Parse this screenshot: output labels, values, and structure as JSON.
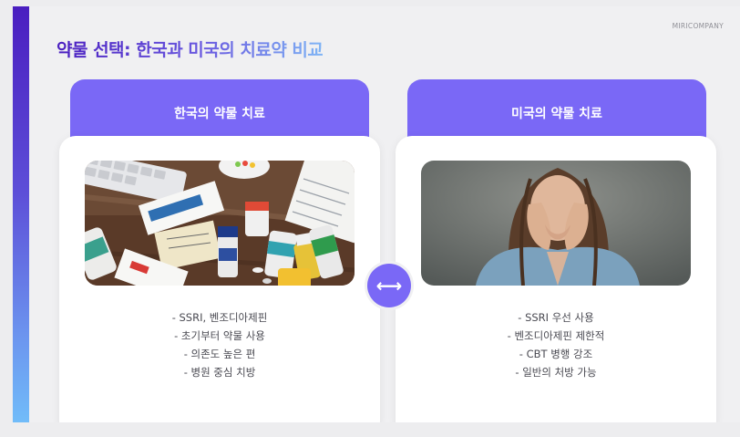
{
  "brand": "MIRICOMPANY",
  "title": "약물 선택: 한국과 미국의 치료약 비교",
  "korea": {
    "header": "한국의 약물 치료",
    "bullets": [
      "- SSRI, 벤조디아제핀",
      "- 초기부터 약물 사용",
      "- 의존도 높은 편",
      "- 병원 중심 치방"
    ]
  },
  "usa": {
    "header": "미국의 약물 치료",
    "bullets": [
      "- SSRI 우선 사용",
      "- 벤조디아제핀 제한적",
      "- CBT 병행 강조",
      "- 일반의 처방 가능"
    ]
  },
  "compare_icon": "left-right-arrow-icon",
  "colors": {
    "accent": "#7a68f6",
    "title_gradient_start": "#4a1ec0",
    "title_gradient_end": "#7fb4f5"
  }
}
